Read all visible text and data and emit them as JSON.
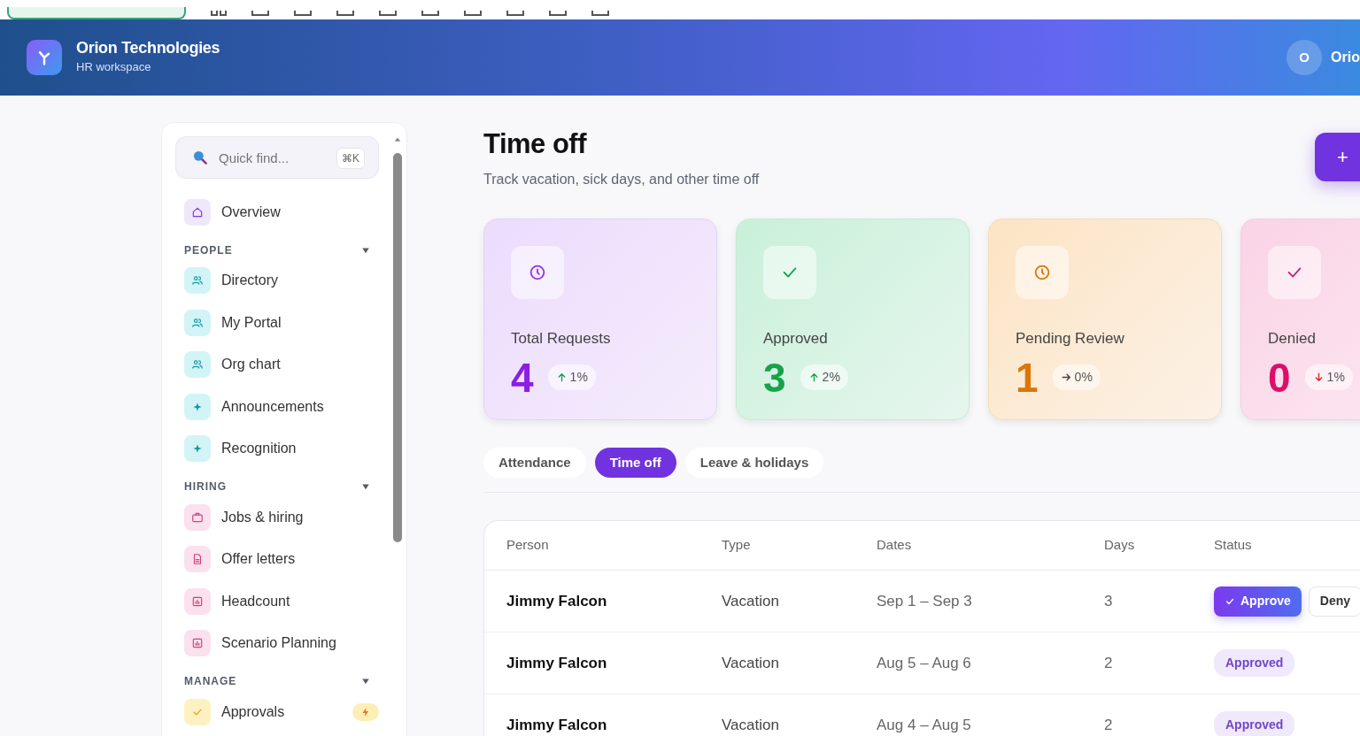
{
  "header": {
    "title": "Orion Technologies",
    "subtitle": "HR workspace",
    "avatar": "O",
    "user": "Orio"
  },
  "sidebar": {
    "search": {
      "placeholder": "Quick find...",
      "shortcut": "⌘K"
    },
    "items": [
      {
        "label": "Overview",
        "kind": "home"
      }
    ],
    "sections": [
      {
        "title": "PEOPLE",
        "expanded": true,
        "items": [
          {
            "label": "Directory",
            "kind": "people"
          },
          {
            "label": "My Portal",
            "kind": "people"
          },
          {
            "label": "Org chart",
            "kind": "people"
          },
          {
            "label": "Announcements",
            "kind": "sparkle"
          },
          {
            "label": "Recognition",
            "kind": "sparkle"
          }
        ]
      },
      {
        "title": "HIRING",
        "expanded": true,
        "items": [
          {
            "label": "Jobs & hiring",
            "kind": "briefcase"
          },
          {
            "label": "Offer letters",
            "kind": "document"
          },
          {
            "label": "Headcount",
            "kind": "chart"
          },
          {
            "label": "Scenario Planning",
            "kind": "chart"
          }
        ]
      },
      {
        "title": "MANAGE",
        "expanded": true,
        "items": [
          {
            "label": "Approvals",
            "kind": "check",
            "alert": true
          }
        ]
      }
    ]
  },
  "page": {
    "title": "Time off",
    "subtitle": "Track vacation, sick days, and other time off",
    "add_button": "+"
  },
  "stats": [
    {
      "label": "Total Requests",
      "value": "4",
      "kind": "total",
      "change": {
        "kind": "up",
        "text": "1%"
      }
    },
    {
      "label": "Approved",
      "value": "3",
      "kind": "approved",
      "change": {
        "kind": "up",
        "text": "2%"
      }
    },
    {
      "label": "Pending Review",
      "value": "1",
      "kind": "pending",
      "change": {
        "kind": "flat",
        "text": "0%"
      }
    },
    {
      "label": "Denied",
      "value": "0",
      "kind": "denied",
      "change": {
        "kind": "down",
        "text": "1%"
      }
    }
  ],
  "tabs": [
    {
      "label": "Attendance",
      "selected": false
    },
    {
      "label": "Time off",
      "selected": true
    },
    {
      "label": "Leave & holidays",
      "selected": false
    }
  ],
  "table": {
    "columns": [
      "Person",
      "Type",
      "Dates",
      "Days",
      "Status"
    ],
    "rows": [
      {
        "person": "Jimmy Falcon",
        "type": "Vacation",
        "dates": "Sep 1 – Sep 3",
        "days": "3",
        "status": {
          "kind": "actions",
          "approve": "Approve",
          "deny": "Deny"
        }
      },
      {
        "person": "Jimmy Falcon",
        "type": "Vacation",
        "dates": "Aug 5 – Aug 6",
        "days": "2",
        "status": {
          "kind": "badge",
          "label": "Approved"
        }
      },
      {
        "person": "Jimmy Falcon",
        "type": "Vacation",
        "dates": "Aug 4 – Aug 5",
        "days": "2",
        "status": {
          "kind": "badge",
          "label": "Approved"
        }
      }
    ]
  }
}
